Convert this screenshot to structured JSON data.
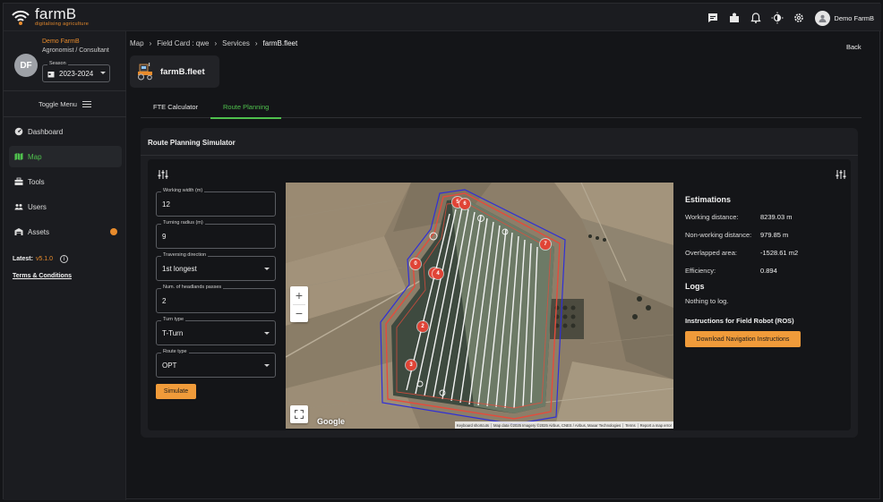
{
  "app": {
    "logo_name": "farmB",
    "logo_tagline": "digitalising agriculture"
  },
  "topbar": {
    "icons": [
      "chat-icon",
      "dashboard-icon",
      "bell-icon",
      "theme-icon",
      "gear-icon"
    ],
    "user_name": "Demo FarmB"
  },
  "profile": {
    "initials": "DF",
    "name": "Demo FarmB",
    "role": "Agronomist / Consultant",
    "season_label": "Season",
    "season_value": "2023-2024"
  },
  "sidebar": {
    "toggle_label": "Toggle Menu",
    "items": [
      {
        "label": "Dashboard",
        "icon": "gauge-icon"
      },
      {
        "label": "Map",
        "icon": "map-icon"
      },
      {
        "label": "Tools",
        "icon": "toolbox-icon"
      },
      {
        "label": "Users",
        "icon": "users-icon"
      },
      {
        "label": "Assets",
        "icon": "warehouse-icon"
      }
    ],
    "latest_label": "Latest:",
    "latest_version": "v5.1.0",
    "terms": "Terms & Conditions"
  },
  "breadcrumb": {
    "items": [
      "Map",
      "Field Card : qwe",
      "Services",
      "farmB.fleet"
    ],
    "back": "Back"
  },
  "app_card": {
    "title": "farmB.fleet"
  },
  "tabs": [
    {
      "label": "FTE Calculator"
    },
    {
      "label": "Route Planning"
    }
  ],
  "panel": {
    "title": "Route Planning Simulator"
  },
  "form": {
    "fields": [
      {
        "label": "Working width (m)",
        "value": "12"
      },
      {
        "label": "Turning radius (m)",
        "value": "9"
      },
      {
        "label": "Traversing direction",
        "value": "1st longest"
      },
      {
        "label": "Num. of headlands passes",
        "value": "2"
      },
      {
        "label": "Turn type",
        "value": "T-Turn"
      },
      {
        "label": "Route type",
        "value": "OPT"
      }
    ],
    "simulate": "Simulate"
  },
  "map": {
    "zoom_in": "+",
    "zoom_out": "−",
    "google": "Google",
    "markers": [
      "0",
      "1",
      "2",
      "3",
      "4",
      "5",
      "6",
      "7"
    ],
    "attribution": [
      "Keyboard shortcuts",
      "Map data ©2025 Imagery ©2025 Airbus, CNES / Airbus, Maxar Technologies",
      "Terms",
      "Report a map error"
    ]
  },
  "estimations": {
    "title": "Estimations",
    "rows": [
      {
        "label": "Working distance:",
        "value": "8239.03 m"
      },
      {
        "label": "Non-working distance:",
        "value": "979.85 m"
      },
      {
        "label": "Overlapped area:",
        "value": "-1528.61 m2"
      },
      {
        "label": "Efficiency:",
        "value": "0.894"
      }
    ],
    "logs_title": "Logs",
    "logs_text": "Nothing to log.",
    "ros_title": "Instructions for Field Robot (ROS)",
    "download": "Download Navigation Instructions"
  },
  "colors": {
    "accent_green": "#4fc14d",
    "accent_orange": "#e88b2c",
    "button_orange": "#f09b3a"
  }
}
